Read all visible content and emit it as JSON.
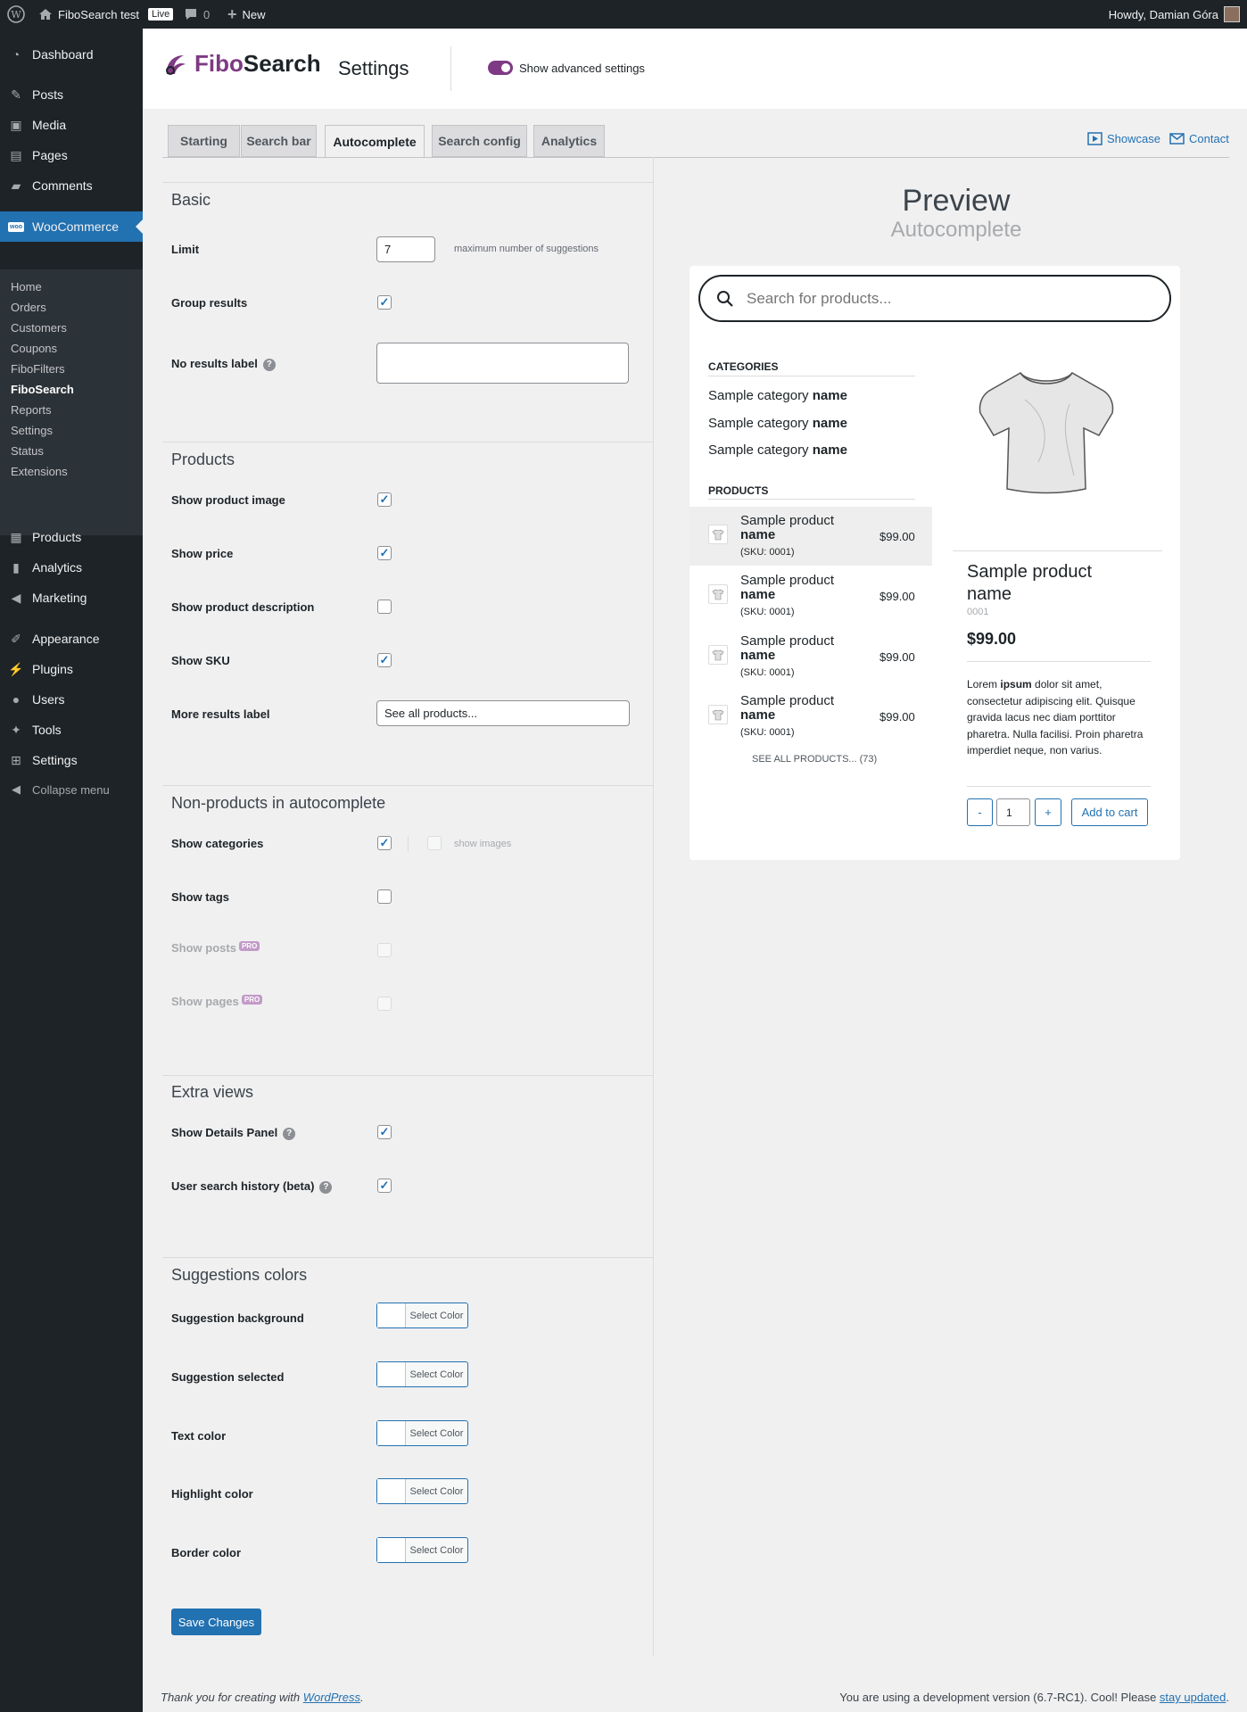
{
  "admin_bar": {
    "site_name": "FiboSearch test",
    "live_badge": "Live",
    "comments_count": "0",
    "new_label": "New",
    "howdy": "Howdy, Damian Góra"
  },
  "sidebar": {
    "dashboard": "Dashboard",
    "posts": "Posts",
    "media": "Media",
    "pages": "Pages",
    "comments": "Comments",
    "woocommerce": "WooCommerce",
    "woo_sub": [
      "Home",
      "Orders",
      "Customers",
      "Coupons",
      "FiboFilters",
      "FiboSearch",
      "Reports",
      "Settings",
      "Status",
      "Extensions"
    ],
    "products": "Products",
    "analytics": "Analytics",
    "marketing": "Marketing",
    "appearance": "Appearance",
    "plugins": "Plugins",
    "users": "Users",
    "tools": "Tools",
    "settings": "Settings",
    "collapse": "Collapse menu"
  },
  "header": {
    "logo_fibo": "Fibo",
    "logo_search": "Search",
    "title": "Settings",
    "advanced_toggle": "Show advanced settings"
  },
  "tabs": [
    "Starting",
    "Search bar",
    "Autocomplete",
    "Search config",
    "Analytics"
  ],
  "links": {
    "showcase": "Showcase",
    "contact": "Contact"
  },
  "form": {
    "basic": {
      "title": "Basic",
      "limit_label": "Limit",
      "limit_value": "7",
      "limit_hint": "maximum number of suggestions",
      "group_label": "Group results",
      "no_results_label": "No results label"
    },
    "products": {
      "title": "Products",
      "image_label": "Show product image",
      "price_label": "Show price",
      "desc_label": "Show product description",
      "sku_label": "Show SKU",
      "more_label": "More results label",
      "more_value": "See all products..."
    },
    "nonproducts": {
      "title": "Non-products in autocomplete",
      "categories_label": "Show categories",
      "show_images": "show images",
      "tags_label": "Show tags",
      "posts_label": "Show posts",
      "pages_label": "Show pages",
      "pro": "PRO"
    },
    "extra": {
      "title": "Extra views",
      "details_label": "Show Details Panel",
      "history_label": "User search history (beta)"
    },
    "colors": {
      "title": "Suggestions colors",
      "items": [
        "Suggestion background",
        "Suggestion selected",
        "Text color",
        "Highlight color",
        "Border color"
      ],
      "button": "Select Color"
    },
    "save": "Save Changes"
  },
  "preview": {
    "title": "Preview",
    "subtitle": "Autocomplete",
    "search_placeholder": "Search for products...",
    "categories_head": "CATEGORIES",
    "category_prefix": "Sample category",
    "category_bold": "name",
    "products_head": "PRODUCTS",
    "product_prefix": "Sample product",
    "product_bold": "name",
    "sku": "(SKU: 0001)",
    "price": "$99.00",
    "see_all": "SEE ALL PRODUCTS... (73)",
    "detail_name": "Sample product name",
    "detail_sku": "0001",
    "detail_price": "$99.00",
    "desc_1": "Lorem ",
    "desc_bold": "ipsum",
    "desc_2": " dolor sit amet, consectetur adipiscing elit. Quisque gravida lacus nec diam porttitor pharetra. Nulla facilisi. Proin pharetra imperdiet neque, non varius.",
    "qty_minus": "-",
    "qty_value": "1",
    "qty_plus": "+",
    "add_to_cart": "Add to cart"
  },
  "footer": {
    "thanks": "Thank you for creating with ",
    "wordpress": "WordPress",
    "dot": ".",
    "version": "You are using a development version (6.7-RC1). Cool! Please ",
    "stay_updated": "stay updated",
    "dot2": "."
  },
  "colors": {
    "accent": "#2271b1",
    "brand": "#7e3a84",
    "admin_dark": "#1d2327"
  }
}
